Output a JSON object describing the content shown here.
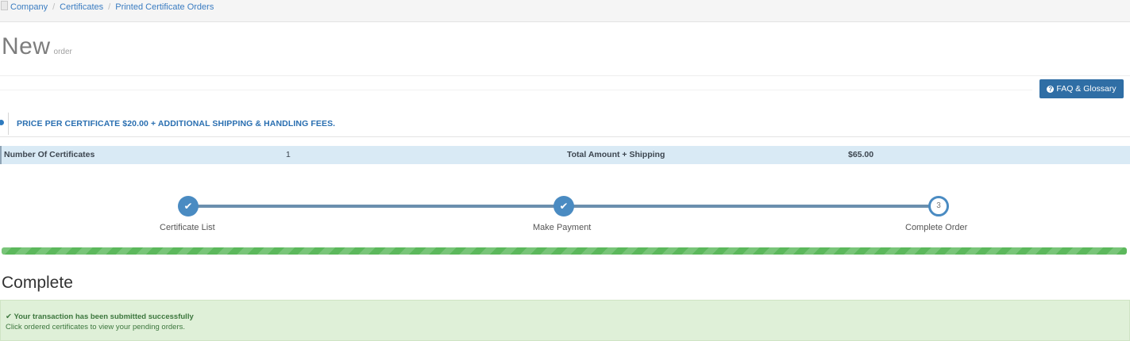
{
  "breadcrumb": {
    "items": [
      "Company",
      "Certificates",
      "Printed Certificate Orders"
    ]
  },
  "page": {
    "title": "New",
    "subtitle": "order"
  },
  "faq_button": {
    "label": "FAQ & Glossary"
  },
  "info": {
    "text": "PRICE PER CERTIFICATE $20.00 + ADDITIONAL SHIPPING & HANDLING FEES."
  },
  "summary": {
    "count_label": "Number Of Certificates",
    "count_value": "1",
    "total_label": "Total Amount + Shipping",
    "total_value": "$65.00"
  },
  "steps": [
    {
      "label": "Certificate List",
      "state": "done"
    },
    {
      "label": "Make Payment",
      "state": "done"
    },
    {
      "label": "Complete Order",
      "state": "current",
      "number": "3"
    }
  ],
  "progress": {
    "percent": 100
  },
  "complete": {
    "heading": "Complete",
    "success_title": "Your transaction has been submitted successfully",
    "success_sub": "Click ordered certificates to view your pending orders."
  },
  "colors": {
    "accent": "#2f6ea5",
    "success": "#5cb85c",
    "info_bg": "#d9eaf5"
  }
}
